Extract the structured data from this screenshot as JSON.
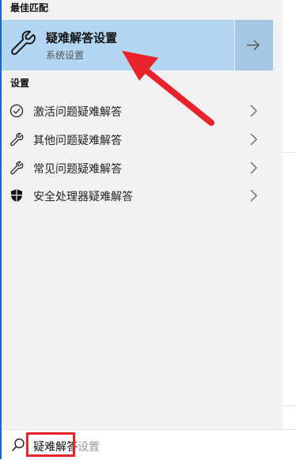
{
  "best_match": {
    "section_label": "最佳匹配",
    "title": "疑难解答设置",
    "subtitle": "系统设置",
    "icon": "wrench-icon",
    "open_icon": "arrow-right-icon"
  },
  "settings": {
    "section_label": "设置",
    "items": [
      {
        "label": "激活问题疑难解答",
        "icon": "check-circle-icon"
      },
      {
        "label": "其他问题疑难解答",
        "icon": "wrench-icon"
      },
      {
        "label": "常见问题疑难解答",
        "icon": "wrench-icon"
      },
      {
        "label": "安全处理器疑难解答",
        "icon": "shield-icon"
      }
    ]
  },
  "search": {
    "typed": "疑难解答",
    "suggestion_suffix": "设置",
    "icon": "search-icon"
  },
  "colors": {
    "accent": "#1e63c7",
    "best_match_bg": "#b3d6f3",
    "annotation_red": "#e8232b"
  }
}
